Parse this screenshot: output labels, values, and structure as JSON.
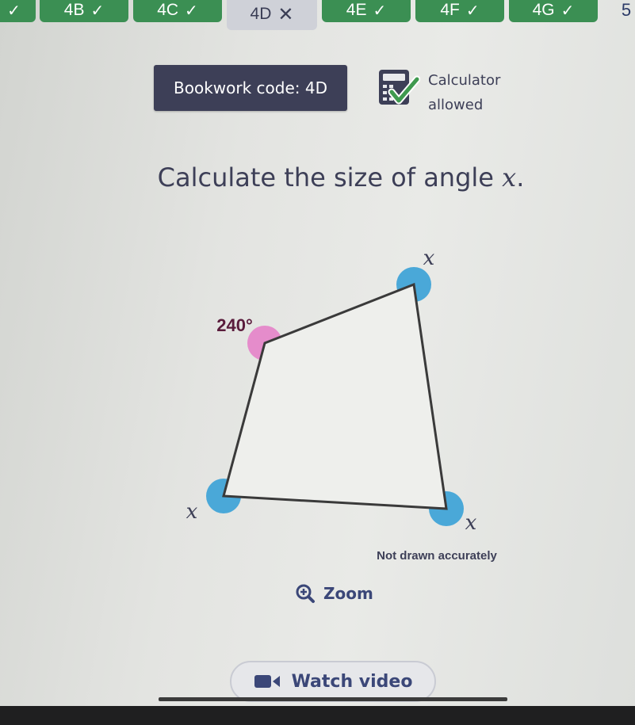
{
  "tabs": [
    {
      "label": "4B",
      "status": "correct"
    },
    {
      "label": "4C",
      "status": "correct"
    },
    {
      "label": "4D",
      "status": "current"
    },
    {
      "label": "4E",
      "status": "correct"
    },
    {
      "label": "4F",
      "status": "correct"
    },
    {
      "label": "4G",
      "status": "correct"
    },
    {
      "label": "5",
      "status": "partial"
    }
  ],
  "header": {
    "bookwork_code": "Bookwork code: 4D",
    "calculator_line1": "Calculator",
    "calculator_line2": "allowed"
  },
  "question": {
    "text": "Calculate the size of angle ",
    "variable": "x",
    "end": "."
  },
  "diagram": {
    "angle_label": "240°",
    "var_top_right": "x",
    "var_bottom_left": "x",
    "var_bottom_right": "x",
    "note": "Not drawn accurately"
  },
  "zoom_label": "Zoom",
  "video_label": "Watch video",
  "colors": {
    "tab_green": "#3b8f53",
    "bookwork_bg": "#3d3f57",
    "angle_blue": "#4aa8d8",
    "angle_pink": "#e58ccb",
    "link_blue": "#3b4778"
  }
}
